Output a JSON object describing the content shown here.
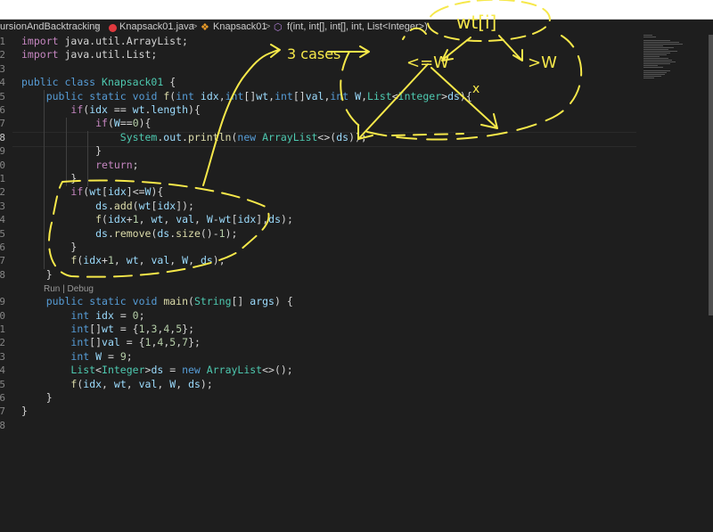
{
  "breadcrumbs": {
    "folder": "ursionAndBacktracking",
    "file": "Knapsack01.java",
    "class_name": "Knapsack01",
    "method": "f(int, int[], int[], int, List<Integer>)",
    "separator": ">"
  },
  "editor": {
    "line_numbers": [
      "1",
      "2",
      "3",
      "4",
      "5",
      "6",
      "7",
      "8",
      "9",
      "0",
      "1",
      "2",
      "3",
      "4",
      "5",
      "6",
      "7",
      "8",
      "9",
      "0",
      "1",
      "2",
      "3",
      "4",
      "5",
      "6",
      "7",
      "8"
    ],
    "codelens": "Run | Debug",
    "lines": [
      [
        {
          "t": "import",
          "c": "ctl"
        },
        {
          "t": " java.util.ArrayList;",
          "c": "pu"
        }
      ],
      [
        {
          "t": "import",
          "c": "ctl"
        },
        {
          "t": " java.util.List;",
          "c": "pu"
        }
      ],
      [],
      [
        {
          "t": "public",
          "c": "kw"
        },
        {
          "t": " ",
          "c": "pu"
        },
        {
          "t": "class",
          "c": "kw"
        },
        {
          "t": " ",
          "c": "pu"
        },
        {
          "t": "Knapsack01",
          "c": "ty"
        },
        {
          "t": " {",
          "c": "pu"
        }
      ],
      [
        {
          "t": "    ",
          "c": "pu"
        },
        {
          "t": "public",
          "c": "kw"
        },
        {
          "t": " ",
          "c": "pu"
        },
        {
          "t": "static",
          "c": "kw"
        },
        {
          "t": " ",
          "c": "pu"
        },
        {
          "t": "void",
          "c": "kw"
        },
        {
          "t": " ",
          "c": "pu"
        },
        {
          "t": "f",
          "c": "fn"
        },
        {
          "t": "(",
          "c": "pu"
        },
        {
          "t": "int",
          "c": "kw"
        },
        {
          "t": " ",
          "c": "pu"
        },
        {
          "t": "idx",
          "c": "vr"
        },
        {
          "t": ",",
          "c": "pu"
        },
        {
          "t": "int",
          "c": "kw"
        },
        {
          "t": "[]",
          "c": "pu"
        },
        {
          "t": "wt",
          "c": "vr"
        },
        {
          "t": ",",
          "c": "pu"
        },
        {
          "t": "int",
          "c": "kw"
        },
        {
          "t": "[]",
          "c": "pu"
        },
        {
          "t": "val",
          "c": "vr"
        },
        {
          "t": ",",
          "c": "pu"
        },
        {
          "t": "int",
          "c": "kw"
        },
        {
          "t": " ",
          "c": "pu"
        },
        {
          "t": "W",
          "c": "vr"
        },
        {
          "t": ",",
          "c": "pu"
        },
        {
          "t": "List",
          "c": "ty"
        },
        {
          "t": "<",
          "c": "pu"
        },
        {
          "t": "Integer",
          "c": "ty"
        },
        {
          "t": ">",
          "c": "pu"
        },
        {
          "t": "ds",
          "c": "vr"
        },
        {
          "t": "){",
          "c": "pu"
        }
      ],
      [
        {
          "t": "        ",
          "c": "pu"
        },
        {
          "t": "if",
          "c": "ctl"
        },
        {
          "t": "(",
          "c": "pu"
        },
        {
          "t": "idx",
          "c": "vr"
        },
        {
          "t": " == ",
          "c": "pu"
        },
        {
          "t": "wt",
          "c": "vr"
        },
        {
          "t": ".",
          "c": "pu"
        },
        {
          "t": "length",
          "c": "vr"
        },
        {
          "t": "){",
          "c": "pu"
        }
      ],
      [
        {
          "t": "            ",
          "c": "pu"
        },
        {
          "t": "if",
          "c": "ctl"
        },
        {
          "t": "(",
          "c": "pu"
        },
        {
          "t": "W",
          "c": "vr"
        },
        {
          "t": "==",
          "c": "pu"
        },
        {
          "t": "0",
          "c": "nm"
        },
        {
          "t": "){",
          "c": "pu"
        }
      ],
      [
        {
          "t": "                ",
          "c": "pu"
        },
        {
          "t": "System",
          "c": "ty"
        },
        {
          "t": ".",
          "c": "pu"
        },
        {
          "t": "out",
          "c": "vr"
        },
        {
          "t": ".",
          "c": "pu"
        },
        {
          "t": "println",
          "c": "fn"
        },
        {
          "t": "(",
          "c": "pu"
        },
        {
          "t": "new",
          "c": "kw"
        },
        {
          "t": " ",
          "c": "pu"
        },
        {
          "t": "ArrayList",
          "c": "ty"
        },
        {
          "t": "<>(",
          "c": "pu"
        },
        {
          "t": "ds",
          "c": "vr"
        },
        {
          "t": "));",
          "c": "pu"
        }
      ],
      [
        {
          "t": "            }",
          "c": "pu"
        }
      ],
      [
        {
          "t": "            ",
          "c": "pu"
        },
        {
          "t": "return",
          "c": "ctl"
        },
        {
          "t": ";",
          "c": "pu"
        }
      ],
      [
        {
          "t": "        }",
          "c": "pu"
        }
      ],
      [
        {
          "t": "        ",
          "c": "pu"
        },
        {
          "t": "if",
          "c": "ctl"
        },
        {
          "t": "(",
          "c": "pu"
        },
        {
          "t": "wt",
          "c": "vr"
        },
        {
          "t": "[",
          "c": "pu"
        },
        {
          "t": "idx",
          "c": "vr"
        },
        {
          "t": "]<=",
          "c": "pu"
        },
        {
          "t": "W",
          "c": "vr"
        },
        {
          "t": "){",
          "c": "pu"
        }
      ],
      [
        {
          "t": "            ",
          "c": "pu"
        },
        {
          "t": "ds",
          "c": "vr"
        },
        {
          "t": ".",
          "c": "pu"
        },
        {
          "t": "add",
          "c": "fn"
        },
        {
          "t": "(",
          "c": "pu"
        },
        {
          "t": "wt",
          "c": "vr"
        },
        {
          "t": "[",
          "c": "pu"
        },
        {
          "t": "idx",
          "c": "vr"
        },
        {
          "t": "]);",
          "c": "pu"
        }
      ],
      [
        {
          "t": "            ",
          "c": "pu"
        },
        {
          "t": "f",
          "c": "fn"
        },
        {
          "t": "(",
          "c": "pu"
        },
        {
          "t": "idx",
          "c": "vr"
        },
        {
          "t": "+",
          "c": "pu"
        },
        {
          "t": "1",
          "c": "nm"
        },
        {
          "t": ", ",
          "c": "pu"
        },
        {
          "t": "wt",
          "c": "vr"
        },
        {
          "t": ", ",
          "c": "pu"
        },
        {
          "t": "val",
          "c": "vr"
        },
        {
          "t": ", ",
          "c": "pu"
        },
        {
          "t": "W",
          "c": "vr"
        },
        {
          "t": "-",
          "c": "pu"
        },
        {
          "t": "wt",
          "c": "vr"
        },
        {
          "t": "[",
          "c": "pu"
        },
        {
          "t": "idx",
          "c": "vr"
        },
        {
          "t": "],",
          "c": "pu"
        },
        {
          "t": "ds",
          "c": "vr"
        },
        {
          "t": ");",
          "c": "pu"
        }
      ],
      [
        {
          "t": "            ",
          "c": "pu"
        },
        {
          "t": "ds",
          "c": "vr"
        },
        {
          "t": ".",
          "c": "pu"
        },
        {
          "t": "remove",
          "c": "fn"
        },
        {
          "t": "(",
          "c": "pu"
        },
        {
          "t": "ds",
          "c": "vr"
        },
        {
          "t": ".",
          "c": "pu"
        },
        {
          "t": "size",
          "c": "fn"
        },
        {
          "t": "()-",
          "c": "pu"
        },
        {
          "t": "1",
          "c": "nm"
        },
        {
          "t": ");",
          "c": "pu"
        }
      ],
      [
        {
          "t": "        }",
          "c": "pu"
        }
      ],
      [
        {
          "t": "        ",
          "c": "pu"
        },
        {
          "t": "f",
          "c": "fn"
        },
        {
          "t": "(",
          "c": "pu"
        },
        {
          "t": "idx",
          "c": "vr"
        },
        {
          "t": "+",
          "c": "pu"
        },
        {
          "t": "1",
          "c": "nm"
        },
        {
          "t": ", ",
          "c": "pu"
        },
        {
          "t": "wt",
          "c": "vr"
        },
        {
          "t": ", ",
          "c": "pu"
        },
        {
          "t": "val",
          "c": "vr"
        },
        {
          "t": ", ",
          "c": "pu"
        },
        {
          "t": "W",
          "c": "vr"
        },
        {
          "t": ", ",
          "c": "pu"
        },
        {
          "t": "ds",
          "c": "vr"
        },
        {
          "t": ");",
          "c": "pu"
        }
      ],
      [
        {
          "t": "    }",
          "c": "pu"
        }
      ],
      [
        {
          "t": "    ",
          "c": "pu"
        },
        {
          "t": "public",
          "c": "kw"
        },
        {
          "t": " ",
          "c": "pu"
        },
        {
          "t": "static",
          "c": "kw"
        },
        {
          "t": " ",
          "c": "pu"
        },
        {
          "t": "void",
          "c": "kw"
        },
        {
          "t": " ",
          "c": "pu"
        },
        {
          "t": "main",
          "c": "fn"
        },
        {
          "t": "(",
          "c": "pu"
        },
        {
          "t": "String",
          "c": "ty"
        },
        {
          "t": "[] ",
          "c": "pu"
        },
        {
          "t": "args",
          "c": "vr"
        },
        {
          "t": ") {",
          "c": "pu"
        }
      ],
      [
        {
          "t": "        ",
          "c": "pu"
        },
        {
          "t": "int",
          "c": "kw"
        },
        {
          "t": " ",
          "c": "pu"
        },
        {
          "t": "idx",
          "c": "vr"
        },
        {
          "t": " = ",
          "c": "pu"
        },
        {
          "t": "0",
          "c": "nm"
        },
        {
          "t": ";",
          "c": "pu"
        }
      ],
      [
        {
          "t": "        ",
          "c": "pu"
        },
        {
          "t": "int",
          "c": "kw"
        },
        {
          "t": "[]",
          "c": "pu"
        },
        {
          "t": "wt",
          "c": "vr"
        },
        {
          "t": " = {",
          "c": "pu"
        },
        {
          "t": "1",
          "c": "nm"
        },
        {
          "t": ",",
          "c": "pu"
        },
        {
          "t": "3",
          "c": "nm"
        },
        {
          "t": ",",
          "c": "pu"
        },
        {
          "t": "4",
          "c": "nm"
        },
        {
          "t": ",",
          "c": "pu"
        },
        {
          "t": "5",
          "c": "nm"
        },
        {
          "t": "};",
          "c": "pu"
        }
      ],
      [
        {
          "t": "        ",
          "c": "pu"
        },
        {
          "t": "int",
          "c": "kw"
        },
        {
          "t": "[]",
          "c": "pu"
        },
        {
          "t": "val",
          "c": "vr"
        },
        {
          "t": " = {",
          "c": "pu"
        },
        {
          "t": "1",
          "c": "nm"
        },
        {
          "t": ",",
          "c": "pu"
        },
        {
          "t": "4",
          "c": "nm"
        },
        {
          "t": ",",
          "c": "pu"
        },
        {
          "t": "5",
          "c": "nm"
        },
        {
          "t": ",",
          "c": "pu"
        },
        {
          "t": "7",
          "c": "nm"
        },
        {
          "t": "};",
          "c": "pu"
        }
      ],
      [
        {
          "t": "        ",
          "c": "pu"
        },
        {
          "t": "int",
          "c": "kw"
        },
        {
          "t": " ",
          "c": "pu"
        },
        {
          "t": "W",
          "c": "vr"
        },
        {
          "t": " = ",
          "c": "pu"
        },
        {
          "t": "9",
          "c": "nm"
        },
        {
          "t": ";",
          "c": "pu"
        }
      ],
      [
        {
          "t": "        ",
          "c": "pu"
        },
        {
          "t": "List",
          "c": "ty"
        },
        {
          "t": "<",
          "c": "pu"
        },
        {
          "t": "Integer",
          "c": "ty"
        },
        {
          "t": ">",
          "c": "pu"
        },
        {
          "t": "ds",
          "c": "vr"
        },
        {
          "t": " = ",
          "c": "pu"
        },
        {
          "t": "new",
          "c": "kw"
        },
        {
          "t": " ",
          "c": "pu"
        },
        {
          "t": "ArrayList",
          "c": "ty"
        },
        {
          "t": "<>();",
          "c": "pu"
        }
      ],
      [
        {
          "t": "        ",
          "c": "pu"
        },
        {
          "t": "f",
          "c": "fn"
        },
        {
          "t": "(",
          "c": "pu"
        },
        {
          "t": "idx",
          "c": "vr"
        },
        {
          "t": ", ",
          "c": "pu"
        },
        {
          "t": "wt",
          "c": "vr"
        },
        {
          "t": ", ",
          "c": "pu"
        },
        {
          "t": "val",
          "c": "vr"
        },
        {
          "t": ", ",
          "c": "pu"
        },
        {
          "t": "W",
          "c": "vr"
        },
        {
          "t": ", ",
          "c": "pu"
        },
        {
          "t": "ds",
          "c": "vr"
        },
        {
          "t": ");",
          "c": "pu"
        }
      ],
      [
        {
          "t": "    }",
          "c": "pu"
        }
      ],
      [
        {
          "t": "}",
          "c": "pu"
        }
      ],
      []
    ]
  },
  "annotations": {
    "top_label": "wt[i]",
    "cases_label": "3 cases",
    "le_label": "<=W",
    "gt_label": ">W",
    "cross_mark": "x",
    "ink_color": "#f6e84a"
  },
  "colors": {
    "background": "#1e1e1e",
    "keyword": "#569cd6",
    "control": "#c586c0",
    "type": "#4ec9b0",
    "function": "#dcdcaa",
    "variable": "#9cdcfe",
    "number": "#b5cea8"
  }
}
